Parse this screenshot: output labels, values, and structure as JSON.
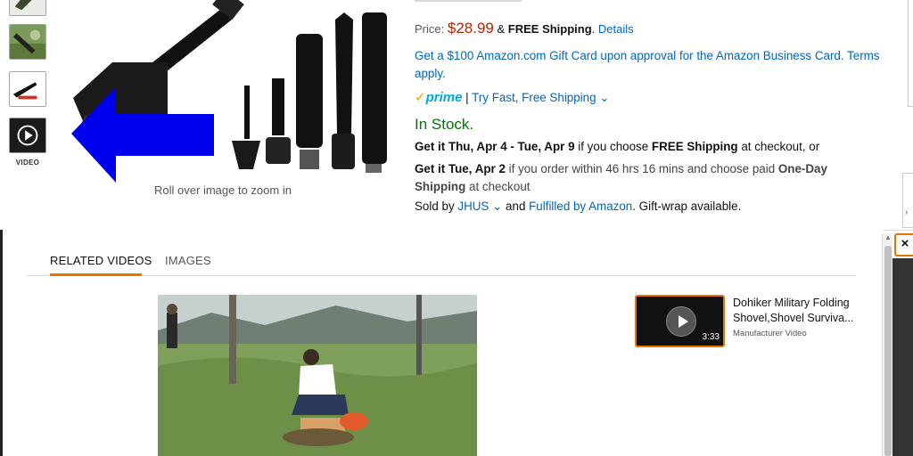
{
  "thumbnails": {
    "items": [
      {
        "name": "thumb-shovel-top"
      },
      {
        "name": "thumb-shovel-garden"
      },
      {
        "name": "thumb-shovel-kit"
      },
      {
        "name": "thumb-video"
      }
    ],
    "video_label": "VIDEO"
  },
  "product_image": {
    "zoom_hint": "Roll over image to zoom in"
  },
  "buybox": {
    "price_label": "Price:",
    "price": "$28.99",
    "ampersand": "&",
    "free_shipping": "FREE Shipping",
    "details_link": ".",
    "details_text": "Details",
    "gift_card": "Get a $100 Amazon.com Gift Card upon approval for the Amazon Business Card. Terms apply.",
    "prime_check": "✓",
    "prime": "prime",
    "prime_separator": "|",
    "prime_link": "Try Fast, Free Shipping",
    "in_stock": "In Stock.",
    "delivery1": {
      "prefix": "Get it Thu, Apr 4 - Tue, Apr 9",
      "middle": " if you choose ",
      "bold": "FREE Shipping",
      "suffix": " at checkout, or"
    },
    "delivery2": {
      "prefix": "Get it Tue, Apr 2",
      "middle": " if you order within 46 hrs 16 mins and choose paid ",
      "bold": "One-Day Shipping",
      "suffix": " at checkout"
    },
    "sold_by": {
      "prefix": "Sold by ",
      "seller": "JHUS",
      "and": " and ",
      "fulfilled": "Fulfilled by Amazon",
      "suffix": ". Gift-wrap available."
    }
  },
  "lightbox": {
    "close": "×",
    "tabs": [
      {
        "label": "RELATED VIDEOS",
        "active": true
      },
      {
        "label": "IMAGES",
        "active": false
      }
    ],
    "side_video": {
      "title": "Dohiker Military Folding Shovel,Shovel Surviva...",
      "duration": "3:33",
      "subtitle": "Manufacturer Video"
    }
  },
  "colors": {
    "accent": "#e77600",
    "price": "#b12704",
    "link": "#0066c0",
    "in_stock": "#007600",
    "arrow": "#0000ee"
  }
}
